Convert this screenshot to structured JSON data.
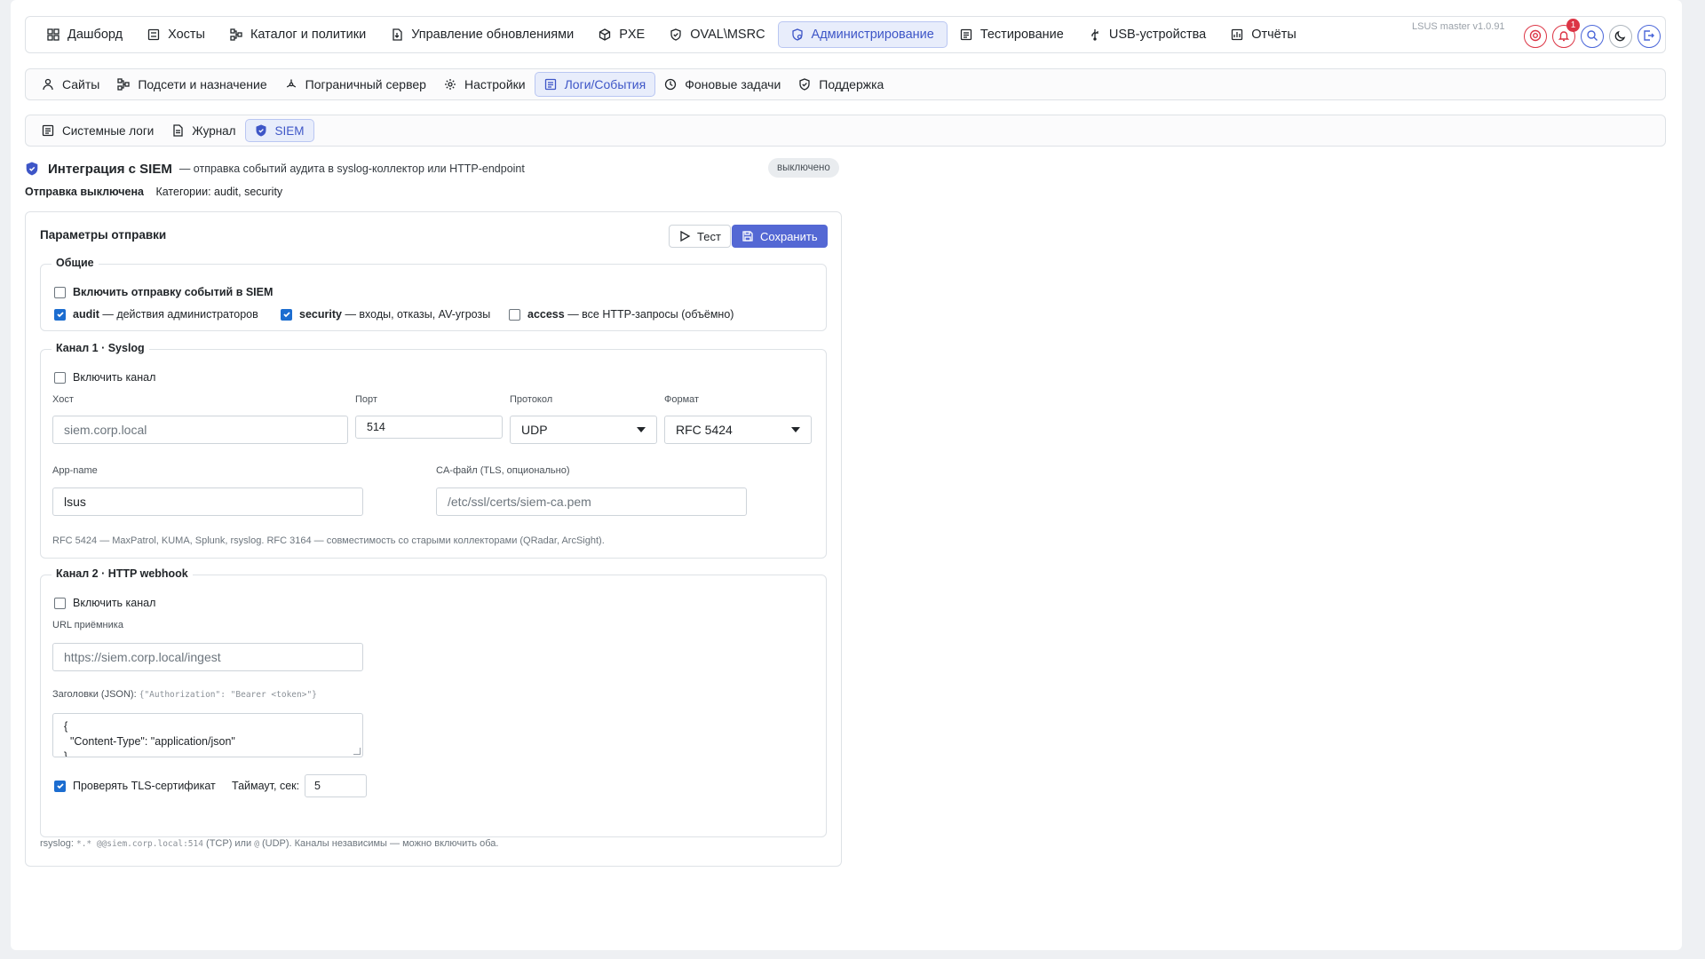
{
  "topnav": {
    "items": [
      {
        "label": "Дашборд",
        "icon": "grid-icon"
      },
      {
        "label": "Хосты",
        "icon": "server-icon"
      },
      {
        "label": "Каталог и политики",
        "icon": "catalog-icon"
      },
      {
        "label": "Управление обновлениями",
        "icon": "download-icon"
      },
      {
        "label": "PXE",
        "icon": "cube-icon"
      },
      {
        "label": "OVAL\\MSRC",
        "icon": "shield-check-icon"
      },
      {
        "label": "Администрирование",
        "icon": "admin-icon",
        "active": true
      },
      {
        "label": "Тестирование",
        "icon": "flask-icon"
      },
      {
        "label": "USB-устройства",
        "icon": "usb-icon"
      },
      {
        "label": "Отчёты",
        "icon": "report-icon"
      }
    ],
    "version": "LSUS master v1.0.91",
    "notifications_count": "1"
  },
  "subnav": {
    "items": [
      {
        "label": "Сайты",
        "icon": "site-icon"
      },
      {
        "label": "Подсети и назначение",
        "icon": "network-icon"
      },
      {
        "label": "Пограничный сервер",
        "icon": "edge-icon"
      },
      {
        "label": "Настройки",
        "icon": "gear-icon"
      },
      {
        "label": "Логи/События",
        "icon": "log-icon",
        "active": true
      },
      {
        "label": "Фоновые задачи",
        "icon": "clock-icon"
      },
      {
        "label": "Поддержка",
        "icon": "support-icon"
      }
    ]
  },
  "logtabs": {
    "items": [
      {
        "label": "Системные логи",
        "icon": "syslog-icon"
      },
      {
        "label": "Журнал",
        "icon": "journal-icon"
      },
      {
        "label": "SIEM",
        "icon": "shield-icon",
        "active": true
      }
    ]
  },
  "header": {
    "title": "Интеграция с SIEM",
    "subtitle": "— отправка событий аудита в syslog-коллектор или HTTP-endpoint",
    "status_badge": "выключено",
    "status_text": "Отправка выключена",
    "categories_text": "Категории: audit, security"
  },
  "card": {
    "title": "Параметры отправки",
    "test_label": "Тест",
    "save_label": "Сохранить"
  },
  "general": {
    "legend": "Общие",
    "enable_label": "Включить отправку событий в SIEM",
    "enable_checked": false,
    "audit": {
      "name": "audit",
      "desc": "— действия администраторов",
      "checked": true
    },
    "security": {
      "name": "security",
      "desc": "— входы, отказы, AV-угрозы",
      "checked": true
    },
    "access": {
      "name": "access",
      "desc": "— все HTTP-запросы (объёмно)",
      "checked": false
    }
  },
  "syslog": {
    "legend": "Канал 1 · Syslog",
    "enable_label": "Включить канал",
    "enable_checked": false,
    "host_label": "Хост",
    "host_placeholder": "siem.corp.local",
    "port_label": "Порт",
    "port_value": "514",
    "protocol_label": "Протокол",
    "protocol_value": "UDP",
    "format_label": "Формат",
    "format_value": "RFC 5424",
    "appname_label": "App-name",
    "appname_value": "lsus",
    "cafile_label": "CA-файл (TLS, опционально)",
    "cafile_placeholder": "/etc/ssl/certs/siem-ca.pem",
    "hint": "RFC 5424 — MaxPatrol, KUMA, Splunk, rsyslog. RFC 3164 — совместимость со старыми коллекторами (QRadar, ArcSight)."
  },
  "webhook": {
    "legend": "Канал 2 · HTTP webhook",
    "enable_label": "Включить канал",
    "enable_checked": false,
    "url_label": "URL приёмника",
    "url_placeholder": "https://siem.corp.local/ingest",
    "headers_label": "Заголовки (JSON):",
    "headers_example": "{\"Authorization\": \"Bearer <token>\"}",
    "headers_line1": "{",
    "headers_line2": "  \"Content-Type\": \"application/json\"",
    "headers_line3": "}",
    "tls_label": "Проверять TLS-сертификат",
    "tls_checked": true,
    "timeout_label": "Таймаут, сек:",
    "timeout_value": "5"
  },
  "footer": {
    "prefix": "rsyslog:",
    "code1": "*.* @@siem.corp.local:514",
    "mid": "(TCP) или",
    "code2": "@",
    "suffix": "(UDP). Каналы независимы — можно включить оба."
  },
  "colors": {
    "accent": "#5468d4",
    "active_tab_bg": "#e8edfb",
    "active_tab_text": "#3e56c7",
    "danger": "#dc3545",
    "checkbox": "#1c6dd0"
  }
}
